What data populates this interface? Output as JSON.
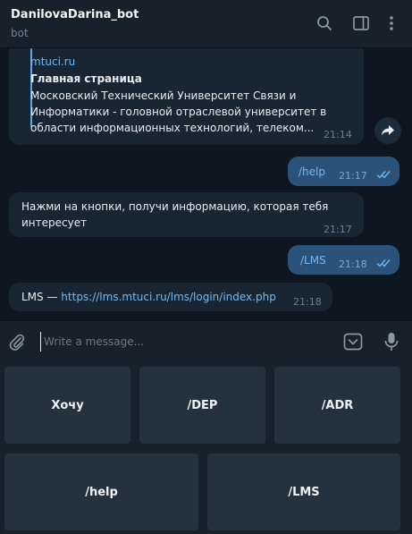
{
  "header": {
    "title": "DanilovaDarina_bot",
    "subtitle": "bot"
  },
  "messages": {
    "preview": {
      "site": "mtuci.ru",
      "heading": "Главная страница",
      "line1": "Московский Технический Университет Связи и",
      "line2": "Информатики -  головной отраслевой университет в",
      "line3": "области информационных технологий, телеком...",
      "time": "21:14"
    },
    "help_cmd": {
      "text": "/help",
      "time": "21:17"
    },
    "bot_reply": {
      "line1": "Нажми на кнопки, получи информацию, которая тебя",
      "line2": "интересует",
      "time": "21:17"
    },
    "lms_cmd": {
      "text": "/LMS",
      "time": "21:18"
    },
    "lms_reply": {
      "prefix": "LMS — ",
      "link": "https://lms.mtuci.ru/lms/login/index.php",
      "time": "21:18"
    }
  },
  "composer": {
    "placeholder": "Write a message..."
  },
  "keyboard": {
    "row1": [
      "Хочу",
      "/DEP",
      "/ADR"
    ],
    "row2": [
      "/help",
      "/LMS"
    ]
  },
  "colors": {
    "background": "#0e1621",
    "panel": "#17212b",
    "incoming": "#182533",
    "outgoing": "#2b5278",
    "link": "#71baf5",
    "keyboard_button": "#243240"
  },
  "icons": [
    "search-icon",
    "sidebar-toggle-icon",
    "more-vertical-icon",
    "share-icon",
    "double-check-icon",
    "paperclip-icon",
    "bot-keyboard-icon",
    "microphone-icon"
  ]
}
